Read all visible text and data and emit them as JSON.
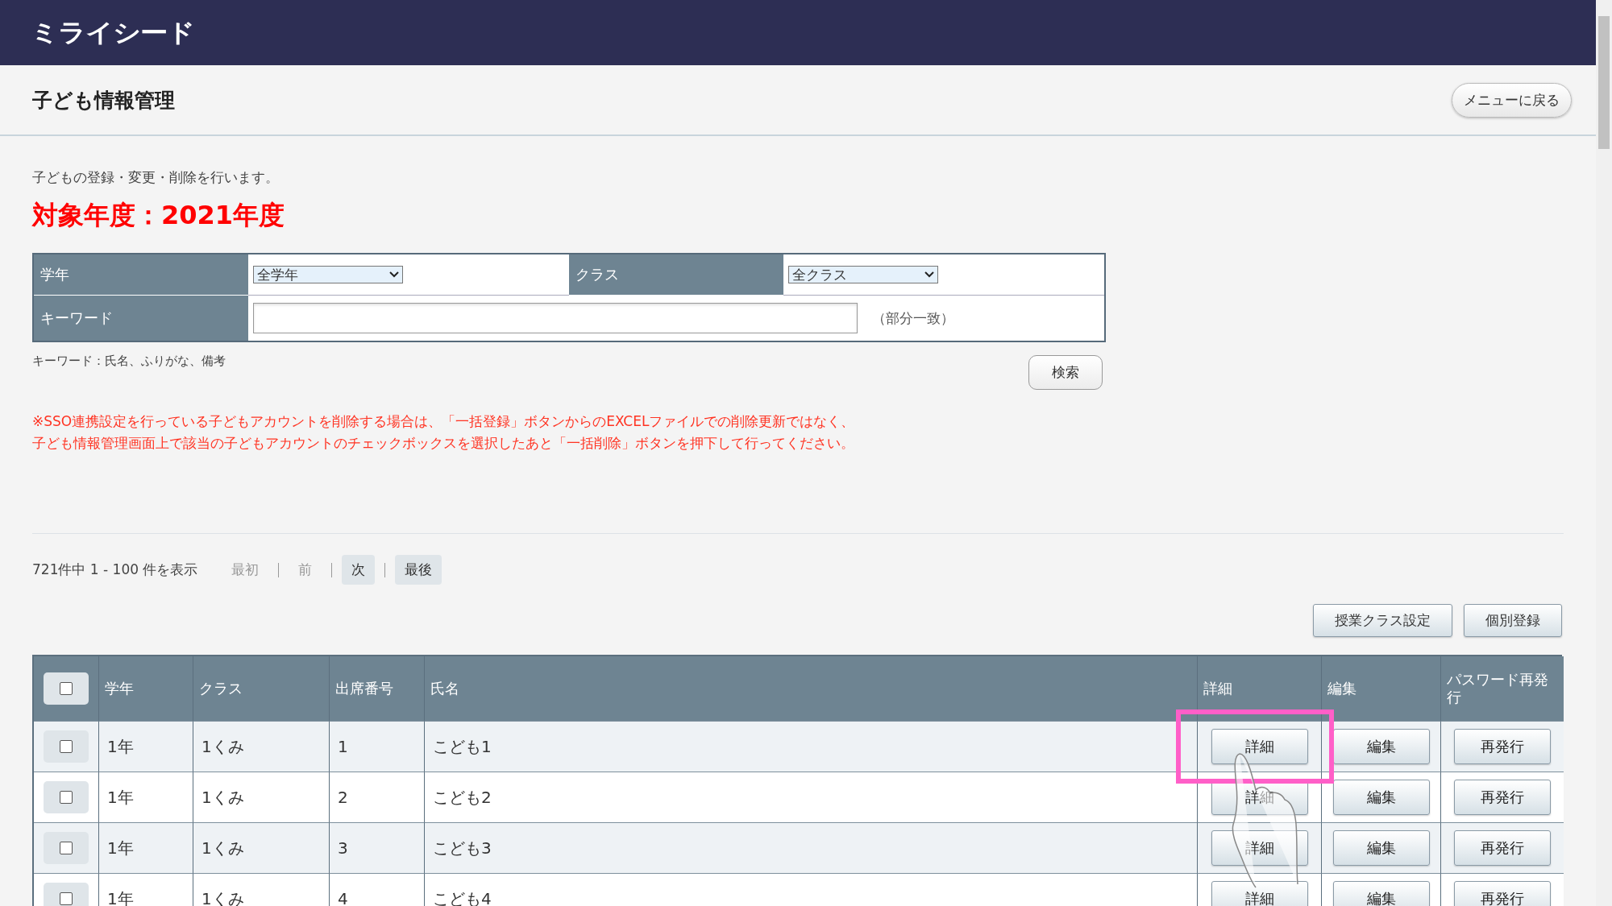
{
  "header": {
    "logo": "ミライシード"
  },
  "page": {
    "title": "子ども情報管理",
    "back_button": "メニューに戻る"
  },
  "description": "子どもの登録・変更・削除を行います。",
  "fiscal_year": "対象年度：2021年度",
  "filter": {
    "grade": {
      "label": "学年",
      "value": "全学年"
    },
    "class": {
      "label": "クラス",
      "value": "全クラス"
    },
    "keyword": {
      "label": "キーワード",
      "hint": "（部分一致）"
    },
    "note": "キーワード：氏名、ふりがな、備考",
    "search_button": "検索"
  },
  "notices": [
    "※SSO連携設定を行っている子どもアカウントを削除する場合は、「一括登録」ボタンからのEXCELファイルでの削除更新ではなく、",
    "子ども情報管理画面上で該当の子どもアカウントのチェックボックスを選択したあと「一括削除」ボタンを押下して行ってください。"
  ],
  "pagination": {
    "summary": "721件中 1 - 100 件を表示",
    "links": [
      {
        "label": "最初",
        "disabled": true
      },
      {
        "label": "前",
        "disabled": true
      },
      {
        "label": "次",
        "disabled": false
      },
      {
        "label": "最後",
        "disabled": false
      }
    ]
  },
  "actions": [
    "授業クラス設定",
    "個別登録"
  ],
  "table": {
    "select_all_checked": false,
    "columns": [
      "学年",
      "クラス",
      "出席番号",
      "氏名",
      "詳細",
      "編集",
      "パスワード再発行"
    ],
    "rows": [
      {
        "checked": false,
        "grade": "1年",
        "class": "1くみ",
        "number": "1",
        "name": "こども1",
        "detail": "詳細",
        "edit": "編集",
        "reissue": "再発行",
        "highlighted": true
      },
      {
        "checked": false,
        "grade": "1年",
        "class": "1くみ",
        "number": "2",
        "name": "こども2",
        "detail": "詳細",
        "edit": "編集",
        "reissue": "再発行",
        "highlighted": false
      },
      {
        "checked": false,
        "grade": "1年",
        "class": "1くみ",
        "number": "3",
        "name": "こども3",
        "detail": "詳細",
        "edit": "編集",
        "reissue": "再発行",
        "highlighted": false
      },
      {
        "checked": false,
        "grade": "1年",
        "class": "1くみ",
        "number": "4",
        "name": "こども4",
        "detail": "詳細",
        "edit": "編集",
        "reissue": "再発行",
        "highlighted": false
      }
    ]
  }
}
